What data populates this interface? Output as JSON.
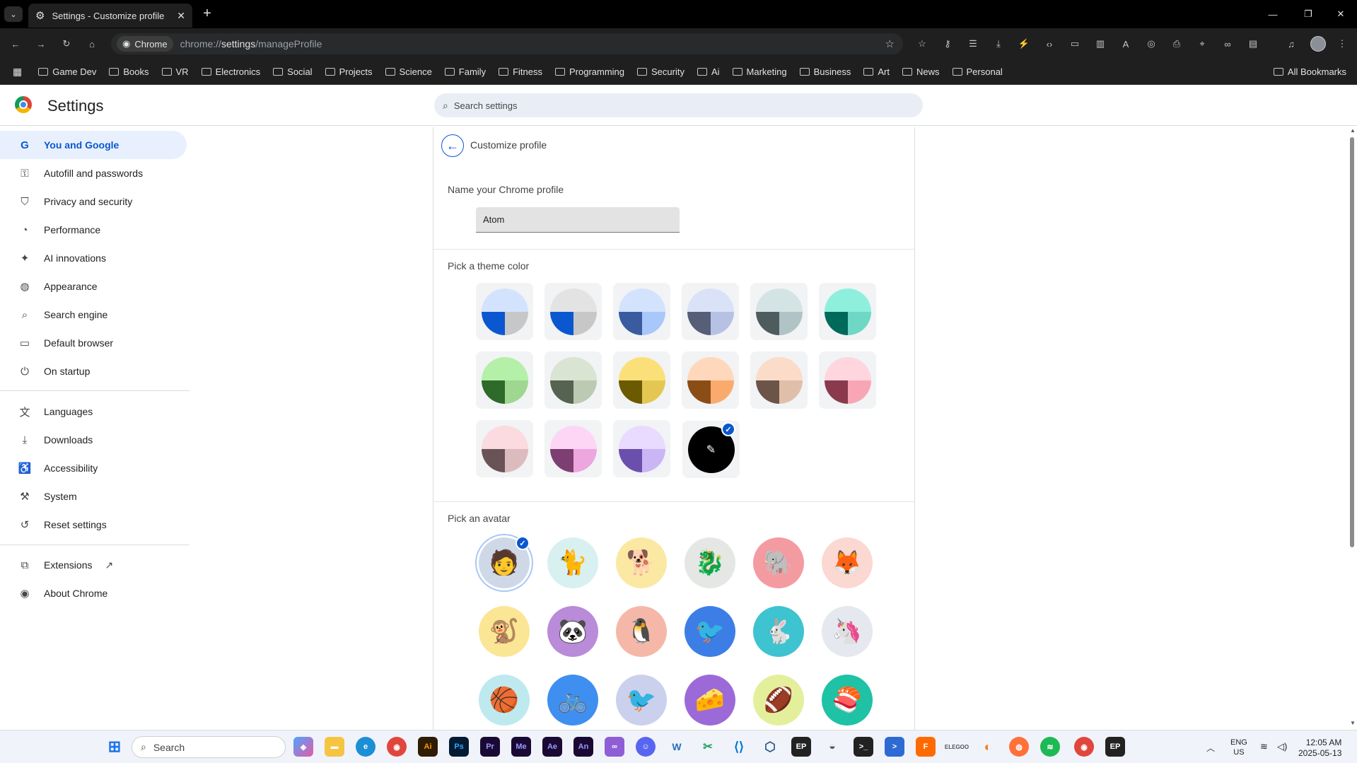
{
  "browser": {
    "tab_title": "Settings - Customize profile",
    "url_chip": "Chrome",
    "url_prefix": "chrome://",
    "url_bold": "settings",
    "url_suffix": "/manageProfile",
    "bookmarks": [
      "Game Dev",
      "Books",
      "VR",
      "Electronics",
      "Social",
      "Projects",
      "Science",
      "Family",
      "Fitness",
      "Programming",
      "Security",
      "Ai",
      "Marketing",
      "Business",
      "Art",
      "News",
      "Personal"
    ],
    "all_bookmarks": "All Bookmarks"
  },
  "header": {
    "title": "Settings",
    "search_placeholder": "Search settings"
  },
  "sidebar": {
    "items": [
      {
        "label": "You and Google",
        "icon": "google-g-icon",
        "selected": true
      },
      {
        "label": "Autofill and passwords",
        "icon": "key-icon"
      },
      {
        "label": "Privacy and security",
        "icon": "shield-icon"
      },
      {
        "label": "Performance",
        "icon": "speedometer-icon"
      },
      {
        "label": "AI innovations",
        "icon": "sparkle-icon"
      },
      {
        "label": "Appearance",
        "icon": "palette-icon"
      },
      {
        "label": "Search engine",
        "icon": "search-icon"
      },
      {
        "label": "Default browser",
        "icon": "browser-window-icon"
      },
      {
        "label": "On startup",
        "icon": "power-icon"
      },
      {
        "label": "Languages",
        "icon": "translate-icon"
      },
      {
        "label": "Downloads",
        "icon": "download-icon"
      },
      {
        "label": "Accessibility",
        "icon": "accessibility-icon"
      },
      {
        "label": "System",
        "icon": "wrench-icon"
      },
      {
        "label": "Reset settings",
        "icon": "reset-icon"
      },
      {
        "label": "Extensions",
        "icon": "puzzle-icon"
      },
      {
        "label": "About Chrome",
        "icon": "chrome-icon"
      }
    ]
  },
  "main": {
    "title": "Customize profile",
    "name_label": "Name your Chrome profile",
    "name_value": "Atom",
    "theme_label": "Pick a theme color",
    "avatar_label": "Pick an avatar",
    "themes": [
      {
        "top": "#d3e3fd",
        "bl": "#0b57d0",
        "br": "#c7c7c7"
      },
      {
        "top": "#e3e3e3",
        "bl": "#0b57d0",
        "br": "#c7c7c7"
      },
      {
        "top": "#d3e3fd",
        "bl": "#3a5ba0",
        "br": "#a8c7fa"
      },
      {
        "top": "#dae2f7",
        "bl": "#565e78",
        "br": "#b7c1e3"
      },
      {
        "top": "#d4e3e4",
        "bl": "#4f5c5e",
        "br": "#b0c3c5"
      },
      {
        "top": "#8ef0dc",
        "bl": "#006a5a",
        "br": "#6fd8c5"
      },
      {
        "top": "#b4f0a8",
        "bl": "#2e6a2a",
        "br": "#9fd690"
      },
      {
        "top": "#d9e4d2",
        "bl": "#556350",
        "br": "#bccab4"
      },
      {
        "top": "#fbe07a",
        "bl": "#6b5a00",
        "br": "#e4c752"
      },
      {
        "top": "#ffd8bc",
        "bl": "#8a4d16",
        "br": "#fbaa6e"
      },
      {
        "top": "#fbdcc9",
        "bl": "#6b5448",
        "br": "#e0bfaa"
      },
      {
        "top": "#ffd6dd",
        "bl": "#8a3a4c",
        "br": "#f8a6b5"
      },
      {
        "top": "#fbdbdf",
        "bl": "#6a5357",
        "br": "#dcbbbf"
      },
      {
        "top": "#fdd6f5",
        "bl": "#7d3e72",
        "br": "#eea6df"
      },
      {
        "top": "#e8dbff",
        "bl": "#6b4fad",
        "br": "#cab5f5"
      }
    ],
    "avatars": [
      {
        "icon": "user-photo-icon",
        "bg": "#cfd8e6",
        "glyph": "🧑",
        "selected": true
      },
      {
        "icon": "origami-cat-icon",
        "bg": "#d9f0f1",
        "glyph": "🐈"
      },
      {
        "icon": "origami-corgi-icon",
        "bg": "#fbe9a3",
        "glyph": "🐕"
      },
      {
        "icon": "origami-dragon-icon",
        "bg": "#e4e7e4",
        "glyph": "🐉"
      },
      {
        "icon": "origami-elephant-icon",
        "bg": "#f49ba1",
        "glyph": "🐘"
      },
      {
        "icon": "origami-fox-icon",
        "bg": "#fcd8d3",
        "glyph": "🦊"
      },
      {
        "icon": "origami-monkey-icon",
        "bg": "#fbe695",
        "glyph": "🐒"
      },
      {
        "icon": "origami-panda-icon",
        "bg": "#b98bd9",
        "glyph": "🐼"
      },
      {
        "icon": "origami-penguin-icon",
        "bg": "#f5b8a8",
        "glyph": "🐧"
      },
      {
        "icon": "origami-bird-icon",
        "bg": "#3d7ee6",
        "glyph": "🐦"
      },
      {
        "icon": "origami-rabbit-icon",
        "bg": "#3ec3d1",
        "glyph": "🐇"
      },
      {
        "icon": "origami-unicorn-icon",
        "bg": "#e6e8ef",
        "glyph": "🦄"
      },
      {
        "icon": "basketball-icon",
        "bg": "#bde9ef",
        "glyph": "🏀"
      },
      {
        "icon": "bike-icon",
        "bg": "#3f8ff0",
        "glyph": "🚲"
      },
      {
        "icon": "red-bird-icon",
        "bg": "#cbd0ec",
        "glyph": "🐦"
      },
      {
        "icon": "cheese-icon",
        "bg": "#9b6ad8",
        "glyph": "🧀"
      },
      {
        "icon": "football-icon",
        "bg": "#e4ef9c",
        "glyph": "🏈"
      },
      {
        "icon": "sushi-icon",
        "bg": "#1fc2a5",
        "glyph": "🍣"
      }
    ]
  },
  "taskbar": {
    "search": "Search",
    "lang": "ENG",
    "region": "US",
    "time": "12:05 AM",
    "date": "2025-05-13"
  }
}
